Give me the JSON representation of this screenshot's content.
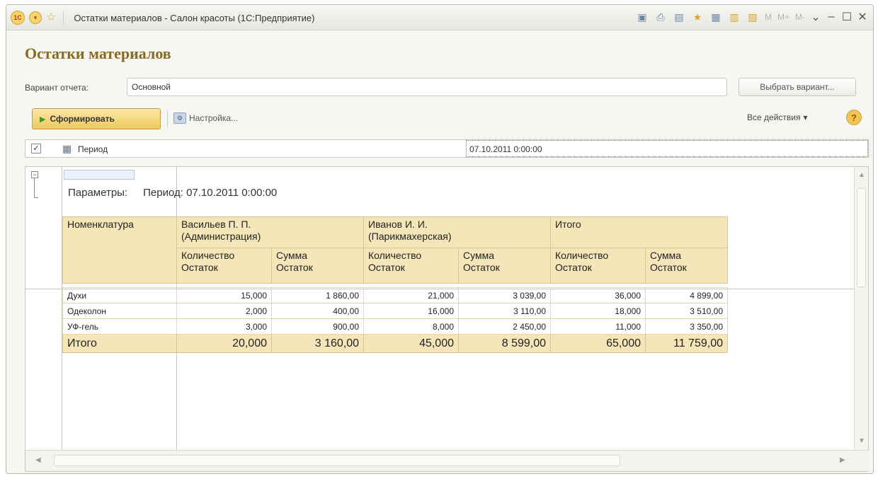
{
  "window": {
    "title": "Остатки материалов - Салон красоты  (1С:Предприятие)",
    "logo_text": "1С",
    "toolbar_text": {
      "m": "M",
      "m_plus": "M+",
      "m_minus": "M-"
    }
  },
  "form": {
    "title": "Остатки материалов",
    "variant_label": "Вариант отчета:",
    "variant_value": "Основной",
    "choose_variant_button": "Выбрать вариант...",
    "generate_button": "Сформировать",
    "settings_button": "Настройка...",
    "all_actions": "Все действия",
    "help": "?"
  },
  "period": {
    "checked": true,
    "label": "Период",
    "value": "07.10.2011 0:00:00"
  },
  "report": {
    "params_label": "Параметры:",
    "params_value": "Период: 07.10.2011 0:00:00",
    "header": {
      "col0": "Номенклатура",
      "group1_line1": "Васильев П. П.",
      "group1_line2": "(Администрация)",
      "group2_line1": "Иванов И. И.",
      "group2_line2": "(Парикмахерская)",
      "group3": "Итого",
      "qty_line1": "Количество",
      "qty_line2": "Остаток",
      "sum_line1": "Сумма",
      "sum_line2": "Остаток"
    },
    "rows": [
      {
        "name": "Духи",
        "c1": "15,000",
        "c2": "1 860,00",
        "c3": "21,000",
        "c4": "3 039,00",
        "c5": "36,000",
        "c6": "4 899,00"
      },
      {
        "name": "Одеколон",
        "c1": "2,000",
        "c2": "400,00",
        "c3": "16,000",
        "c4": "3 110,00",
        "c5": "18,000",
        "c6": "3 510,00"
      },
      {
        "name": "УФ-гель",
        "c1": "3,000",
        "c2": "900,00",
        "c3": "8,000",
        "c4": "2 450,00",
        "c5": "11,000",
        "c6": "3 350,00"
      }
    ],
    "total": {
      "name": "Итого",
      "c1": "20,000",
      "c2": "3 160,00",
      "c3": "45,000",
      "c4": "8 599,00",
      "c5": "65,000",
      "c6": "11 759,00"
    }
  }
}
